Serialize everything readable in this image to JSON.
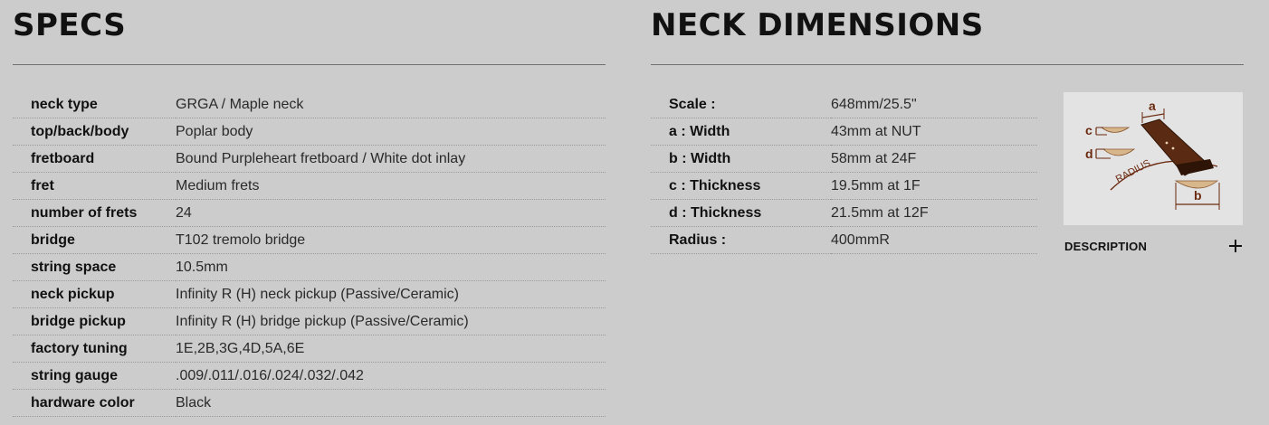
{
  "specs": {
    "title": "SPECS",
    "rows": [
      {
        "label": "neck type",
        "value": "GRGA / Maple neck"
      },
      {
        "label": "top/back/body",
        "value": "Poplar body"
      },
      {
        "label": "fretboard",
        "value": "Bound Purpleheart fretboard / White dot inlay"
      },
      {
        "label": "fret",
        "value": "Medium frets"
      },
      {
        "label": "number of frets",
        "value": "24"
      },
      {
        "label": "bridge",
        "value": "T102 tremolo bridge"
      },
      {
        "label": "string space",
        "value": "10.5mm"
      },
      {
        "label": "neck pickup",
        "value": "Infinity R (H) neck pickup (Passive/Ceramic)"
      },
      {
        "label": "bridge pickup",
        "value": "Infinity R (H) bridge pickup (Passive/Ceramic)"
      },
      {
        "label": "factory tuning",
        "value": "1E,2B,3G,4D,5A,6E"
      },
      {
        "label": "string gauge",
        "value": ".009/.011/.016/.024/.032/.042"
      },
      {
        "label": "hardware color",
        "value": "Black"
      }
    ]
  },
  "neck": {
    "title": "NECK DIMENSIONS",
    "rows": [
      {
        "label": "Scale :",
        "value": "648mm/25.5\""
      },
      {
        "label": "a : Width",
        "value": "43mm at NUT"
      },
      {
        "label": "b : Width",
        "value": "58mm at 24F"
      },
      {
        "label": "c : Thickness",
        "value": "19.5mm at 1F"
      },
      {
        "label": "d : Thickness",
        "value": "21.5mm at 12F"
      },
      {
        "label": "Radius :",
        "value": "400mmR"
      }
    ],
    "diagram": {
      "labels": {
        "a": "a",
        "b": "b",
        "c": "c",
        "d": "d",
        "radius": "RADIUS"
      },
      "colors": {
        "neck": "#5b2a12",
        "neck_edge": "#2e1407",
        "profile": "#d8b68c",
        "dimension_line": "#6b2a10",
        "background": "#e3e3e3"
      }
    },
    "description_label": "DESCRIPTION",
    "expand_icon": "plus-icon"
  }
}
